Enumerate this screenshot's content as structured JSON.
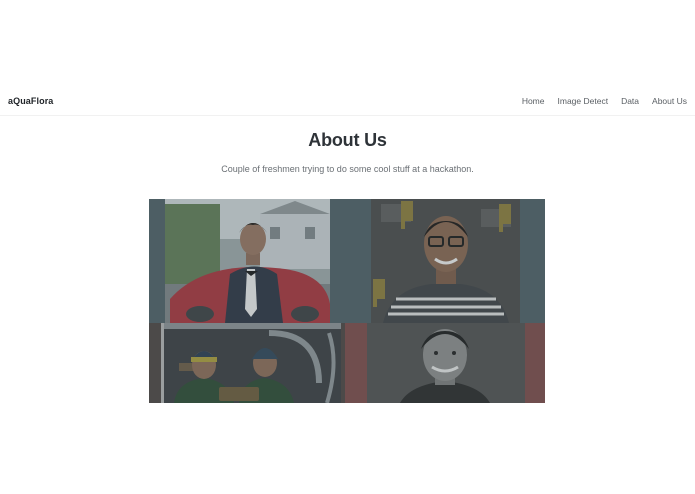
{
  "navbar": {
    "brand": "aQuaFlora",
    "links": [
      {
        "label": "Home"
      },
      {
        "label": "Image Detect"
      },
      {
        "label": "Data"
      },
      {
        "label": "About Us"
      }
    ]
  },
  "main": {
    "title": "About Us",
    "subtitle": "Couple of freshmen trying to do some cool stuff at a hackathon."
  },
  "colors": {
    "overlay": "#4e5e64",
    "heading": "#2e3338",
    "text": "#6a6f74"
  }
}
